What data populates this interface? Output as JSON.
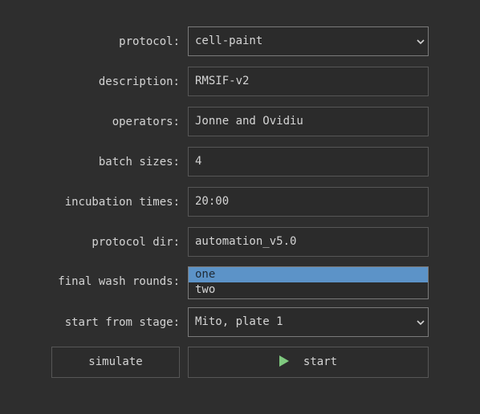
{
  "fields": {
    "protocol": {
      "label": "protocol:",
      "value": "cell-paint"
    },
    "description": {
      "label": "description:",
      "value": "RMSIF-v2"
    },
    "operators": {
      "label": "operators:",
      "value": "Jonne and Ovidiu"
    },
    "batch_sizes": {
      "label": "batch sizes:",
      "value": "4"
    },
    "incubation_times": {
      "label": "incubation times:",
      "value": "20:00"
    },
    "protocol_dir": {
      "label": "protocol dir:",
      "value": "automation_v5.0"
    },
    "final_wash_rounds": {
      "label": "final wash rounds:",
      "options": [
        "one",
        "two"
      ],
      "selected": "one"
    },
    "start_from_stage": {
      "label": "start from stage:",
      "value": "Mito, plate 1"
    }
  },
  "buttons": {
    "simulate": "simulate",
    "start": "start"
  },
  "icons": {
    "start_icon": "play-icon",
    "dropdown_icon": "chevron-down-icon"
  },
  "colors": {
    "background": "#2e2e2e",
    "selected_option": "#5c93c8",
    "play_icon": "#7fc97f"
  }
}
